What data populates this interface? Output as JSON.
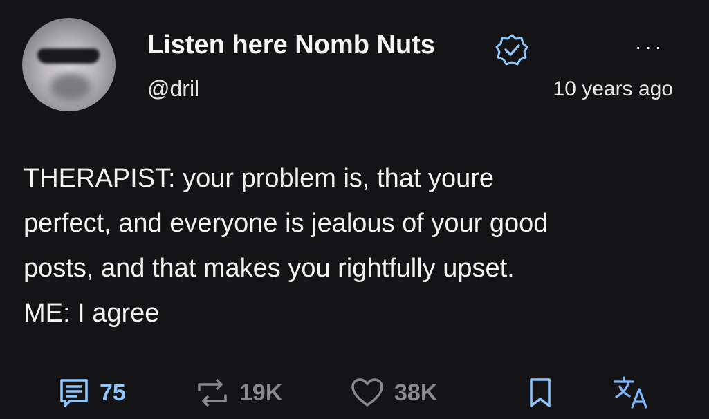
{
  "post": {
    "display_name": "Listen here Nomb Nuts",
    "handle": "@dril",
    "time": "10 years ago",
    "more_label": "···",
    "text_lines": [
      "THERAPIST: your problem is, that youre",
      "perfect, and everyone is jealous of your good",
      "posts, and that makes you rightfully upset.",
      "ME: I agree"
    ]
  },
  "actions": {
    "replies": "75",
    "retweets": "19K",
    "likes": "38K"
  },
  "colors": {
    "background": "#141416",
    "accent": "#8fc8ff",
    "muted": "#8a8a8e"
  },
  "icons": [
    "verified-badge-icon",
    "more-options-icon",
    "reply-icon",
    "retweet-icon",
    "like-icon",
    "bookmark-icon",
    "translate-icon"
  ]
}
